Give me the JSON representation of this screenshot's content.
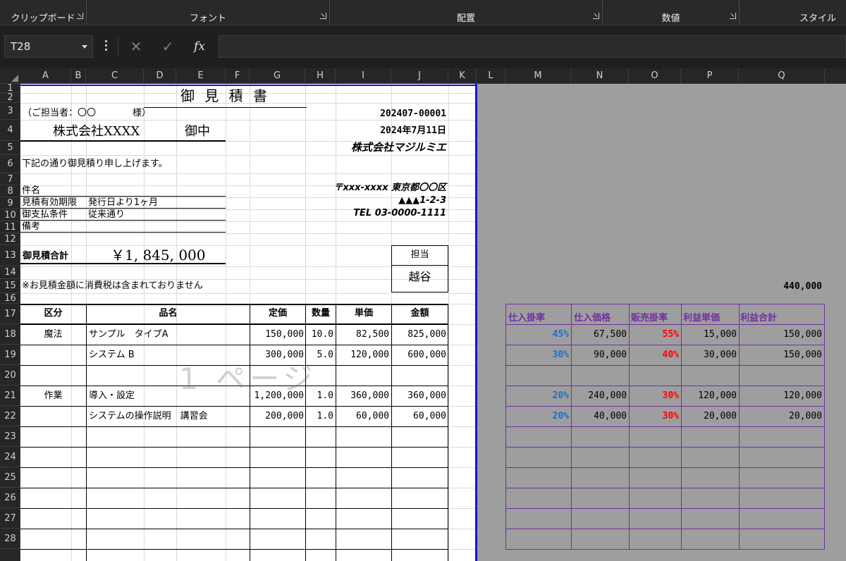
{
  "ribbon": {
    "groups": [
      {
        "label": "クリップボード"
      },
      {
        "label": "フォント"
      },
      {
        "label": "配置"
      },
      {
        "label": "数値"
      },
      {
        "label": "スタイル"
      }
    ]
  },
  "formula_bar": {
    "name_box": "T28",
    "cancel_glyph": "✕",
    "enter_glyph": "✓",
    "fx_glyph": "fx",
    "formula": ""
  },
  "columns": [
    "A",
    "B",
    "C",
    "D",
    "E",
    "F",
    "G",
    "H",
    "I",
    "J",
    "K",
    "L",
    "M",
    "N",
    "O",
    "P",
    "Q"
  ],
  "rows": [
    "1",
    "2",
    "3",
    "4",
    "5",
    "6",
    "7",
    "8",
    "9",
    "10",
    "11",
    "12",
    "13",
    "14",
    "15",
    "16",
    "17",
    "18",
    "19",
    "20",
    "21",
    "22",
    "23",
    "24",
    "25",
    "26",
    "27",
    "28"
  ],
  "quote": {
    "title": "御 見 積 書",
    "contact_line": "（ご担当者：〇〇　　　　様）",
    "customer": "株式会社XXXX",
    "onchu": "御中",
    "doc_no": "202407-00001",
    "date": "2024年7月11日",
    "issuer": "株式会社マジルミエ",
    "intro": "下記の通り御見積り申し上げます。",
    "address1": "〒xxx-xxxx 東京都〇〇区",
    "address2": "▲▲▲1-2-3",
    "tel": "TEL 03-0000-1111",
    "fields": [
      {
        "label": "件名",
        "value": ""
      },
      {
        "label": "見積有効期限",
        "value": "発行日より1ヶ月"
      },
      {
        "label": "御支払条件",
        "value": "従来通り"
      },
      {
        "label": "備考",
        "value": ""
      }
    ],
    "total_label": "御見積合計",
    "total_value": "￥1, 845, 000",
    "tantou_label": "担当",
    "tantou_name": "越谷",
    "tax_note": "※お見積金額に消費税は含まれておりません",
    "headers": {
      "category": "区分",
      "item": "品名",
      "list_price": "定価",
      "qty": "数量",
      "unit_price": "単価",
      "amount": "金額"
    },
    "items": [
      {
        "category": "魔法",
        "item": "サンプル　タイプA",
        "list_price": "150,000",
        "qty": "10.0",
        "unit_price": "82,500",
        "amount": "825,000"
      },
      {
        "category": "",
        "item": "システム B",
        "list_price": "300,000",
        "qty": "5.0",
        "unit_price": "120,000",
        "amount": "600,000"
      },
      {
        "category": "",
        "item": "",
        "list_price": "",
        "qty": "",
        "unit_price": "",
        "amount": ""
      },
      {
        "category": "作業",
        "item": "導入・設定",
        "list_price": "1,200,000",
        "qty": "1.0",
        "unit_price": "360,000",
        "amount": "360,000"
      },
      {
        "category": "",
        "item": "システムの操作説明　講習会",
        "list_price": "200,000",
        "qty": "1.0",
        "unit_price": "60,000",
        "amount": "60,000"
      }
    ],
    "watermark": "1 ページ"
  },
  "side": {
    "profit_total": "440,000",
    "headers": {
      "purchase_rate": "仕入掛率",
      "purchase_price": "仕入価格",
      "sales_rate": "販売掛率",
      "profit_unit": "利益単価",
      "profit_total": "利益合計"
    },
    "rows": [
      {
        "purchase_rate": "45%",
        "purchase_price": "67,500",
        "sales_rate": "55%",
        "profit_unit": "15,000",
        "profit_total": "150,000"
      },
      {
        "purchase_rate": "30%",
        "purchase_price": "90,000",
        "sales_rate": "40%",
        "profit_unit": "30,000",
        "profit_total": "150,000"
      },
      {
        "purchase_rate": "",
        "purchase_price": "",
        "sales_rate": "",
        "profit_unit": "",
        "profit_total": ""
      },
      {
        "purchase_rate": "20%",
        "purchase_price": "240,000",
        "sales_rate": "30%",
        "profit_unit": "120,000",
        "profit_total": "120,000"
      },
      {
        "purchase_rate": "20%",
        "purchase_price": "40,000",
        "sales_rate": "30%",
        "profit_unit": "20,000",
        "profit_total": "20,000"
      }
    ]
  },
  "colors": {
    "page_break": "#1414d6",
    "accent_purple": "#7030a0",
    "rate_blue": "#1f6fc2",
    "rate_red": "#ff0000"
  }
}
